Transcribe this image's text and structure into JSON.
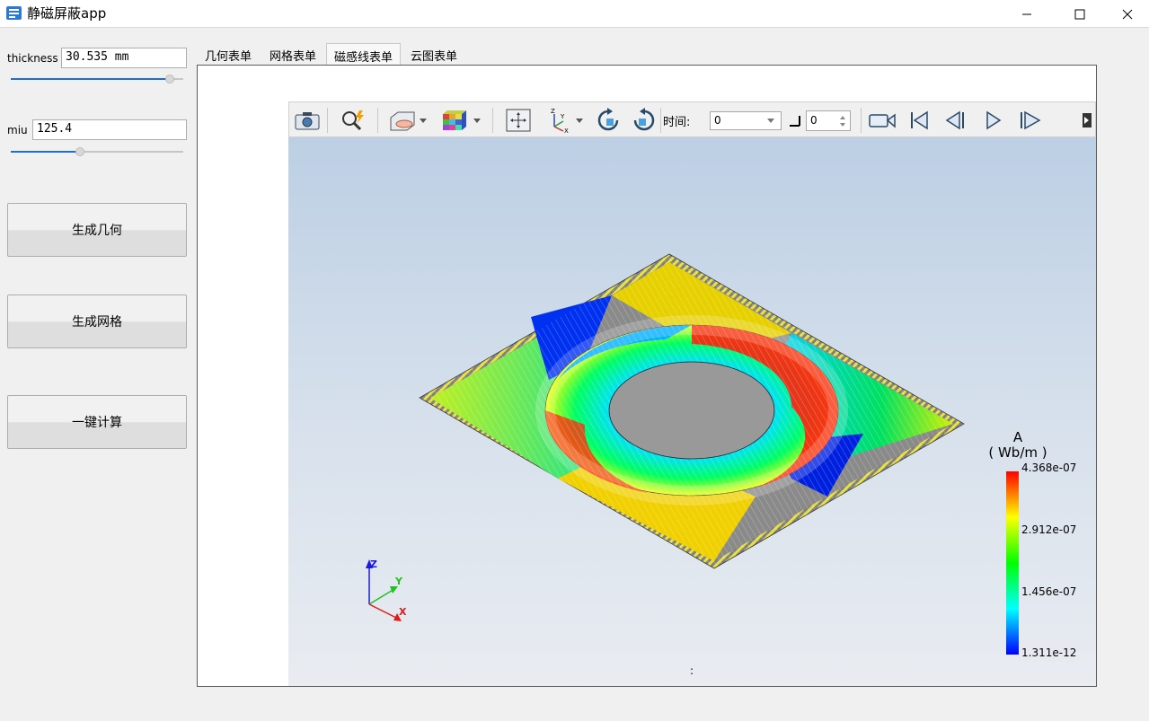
{
  "window": {
    "title": "静磁屏蔽app",
    "controls": [
      "minimize-icon",
      "maximize-icon",
      "close-icon"
    ]
  },
  "params": {
    "thickness": {
      "label": "thickness",
      "value": "30.535 mm",
      "slider_fraction": 0.92
    },
    "miu": {
      "label": "miu",
      "value": "125.4",
      "slider_fraction": 0.4
    }
  },
  "buttons": {
    "generate_geometry": "生成几何",
    "generate_mesh": "生成网格",
    "compute": "一键计算"
  },
  "tabs": [
    {
      "label": "几何表单",
      "active": false
    },
    {
      "label": "网格表单",
      "active": false
    },
    {
      "label": "磁感线表单",
      "active": true
    },
    {
      "label": "云图表单",
      "active": false
    }
  ],
  "toolbar": {
    "time_label": "时间:",
    "time_value": "0",
    "step_value": "0",
    "icons": [
      "camera-icon",
      "zoom-magic-icon",
      "clip-box-icon",
      "color-cube-icon",
      "fit-view-icon",
      "axes-orientation-icon",
      "rotate-cw-icon",
      "rotate-ccw-icon",
      "record-icon",
      "first-frame-icon",
      "prev-frame-icon",
      "play-icon",
      "next-frame-icon"
    ]
  },
  "scene": {
    "colorbar": {
      "title": "A",
      "unit": "( Wb/m )",
      "ticks": [
        "4.368e-07",
        "2.912e-07",
        "1.456e-07",
        "1.311e-12"
      ],
      "colors": [
        "#ff0000",
        "#ffff00",
        "#00ff00",
        "#00ffff",
        "#0000ff"
      ]
    },
    "axes": {
      "x": "X",
      "y": "Y",
      "z": "Z"
    },
    "bottom_text": ":"
  }
}
